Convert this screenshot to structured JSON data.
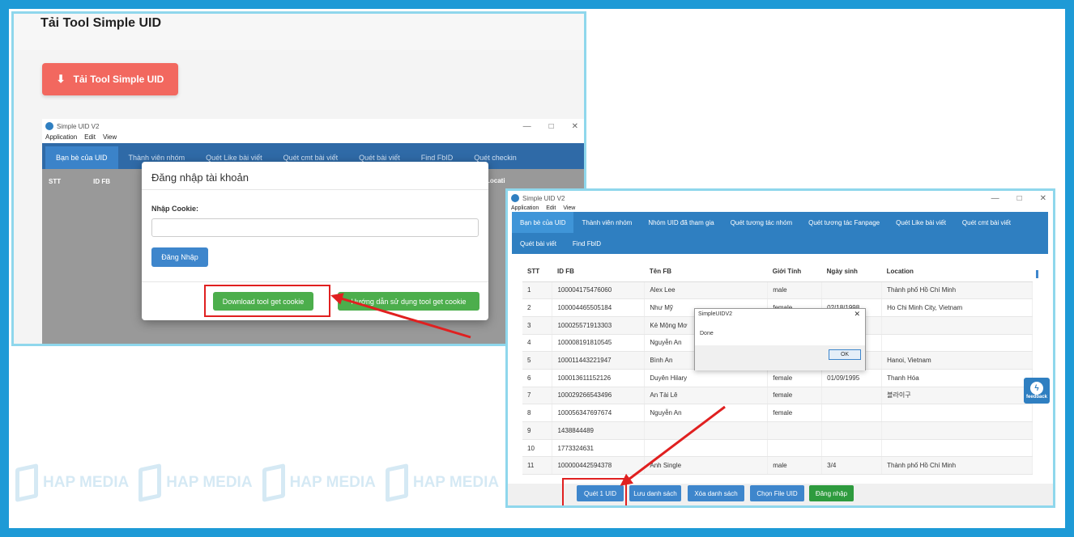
{
  "left_screenshot": {
    "doc_title": "Tải Tool Simple UID",
    "download_button": "Tải Tool Simple UID",
    "window_title": "Simple UID V2",
    "menu": [
      "Application",
      "Edit",
      "View"
    ],
    "tabs": [
      "Bạn bè của UID",
      "Thành viên nhóm",
      "Quét Like bài viết",
      "Quét cmt bài viết",
      "Quét bài viết",
      "Find FbID",
      "Quét checkin"
    ],
    "columns": [
      "STT",
      "ID FB"
    ],
    "column_partial": "Locati",
    "login_modal": {
      "title": "Đăng nhập tài khoản",
      "cookie_label": "Nhập Cookie:",
      "login_button": "Đăng Nhập",
      "get_cookie_button": "Download tool get cookie",
      "guide_button": "Hướng dẫn sử dụng tool get cookie"
    }
  },
  "right_screenshot": {
    "window_title": "Simple UID V2",
    "menu": [
      "Application",
      "Edit",
      "View"
    ],
    "tabs_row1": [
      "Bạn bè của UID",
      "Thành viên nhóm",
      "Nhóm UID đã tham gia",
      "Quét tương tác nhóm",
      "Quét tương tác Fanpage",
      "Quét Like bài viết",
      "Quét cmt bài viết"
    ],
    "tabs_row2": [
      "Quét bài viết",
      "Find FbID"
    ],
    "columns": [
      "STT",
      "ID FB",
      "Tên FB",
      "Giới Tính",
      "Ngày sinh",
      "Location"
    ],
    "rows": [
      [
        "1",
        "100004175476060",
        "Alex Lee",
        "male",
        "",
        "Thành phố Hồ Chí Minh"
      ],
      [
        "2",
        "100004465505184",
        "Như Mỹ",
        "female",
        "02/18/1998",
        "Ho Chi Minh City, Vietnam"
      ],
      [
        "3",
        "100025571913303",
        "Kẻ Mộng Mơ",
        "",
        "",
        ""
      ],
      [
        "4",
        "100008191810545",
        "Nguyễn An",
        "",
        "",
        ""
      ],
      [
        "5",
        "100011443221947",
        "Bình An",
        "",
        "",
        "Hanoi, Vietnam"
      ],
      [
        "6",
        "100013611152126",
        "Duyên Hilary",
        "female",
        "01/09/1995",
        "Thanh Hóa"
      ],
      [
        "7",
        "100029266543496",
        "An Tài Lê",
        "female",
        "",
        "블라이구"
      ],
      [
        "8",
        "100056347697674",
        "Nguyễn An",
        "female",
        "",
        ""
      ],
      [
        "9",
        "1438844489",
        "",
        "",
        "",
        ""
      ],
      [
        "10",
        "1773324631",
        "",
        "",
        "",
        ""
      ],
      [
        "11",
        "100000442594378",
        "Anh Single",
        "male",
        "3/4",
        "Thành phố Hồ Chí Minh"
      ]
    ],
    "done_dialog": {
      "title": "SimpleUIDV2",
      "message": "Done",
      "ok": "OK"
    },
    "bottom_buttons": [
      "Quét 1 UID",
      "Lưu danh sách",
      "Xóa danh sách",
      "Chọn File UID",
      "Đăng nhập"
    ]
  },
  "watermark": {
    "text": [
      "HAP MEDIA",
      "HAP MEDIA",
      "HAP MEDIA",
      "HAP MEDIA"
    ]
  },
  "feedback_label": "feedback",
  "colors": {
    "frame": "#1e9ad6",
    "tab_blue": "#2f7fc1",
    "highlight_red": "#e02020",
    "download_red": "#f2685f",
    "green": "#4cae4c"
  }
}
